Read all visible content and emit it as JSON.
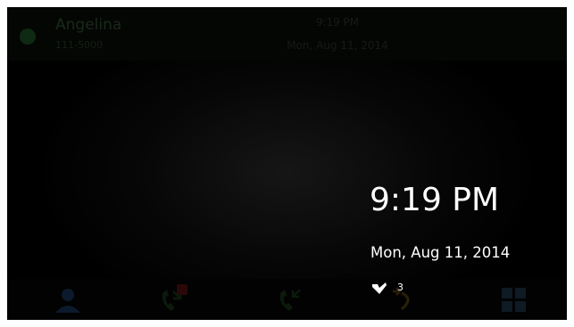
{
  "status_bar": {
    "account_name": "Angelina",
    "account_number": "111-5000",
    "time": "9:19 PM",
    "date": "Mon, Aug 11, 2014",
    "presence_color": "#0e2a12"
  },
  "screensaver": {
    "time": "9:19 PM",
    "date": "Mon, Aug 11, 2014",
    "voicemail_icon": "voicemail-icon",
    "voicemail_count": "3"
  },
  "softkeys": [
    {
      "icon": "contacts-icon"
    },
    {
      "icon": "missed-calls-icon",
      "badge": true
    },
    {
      "icon": "received-calls-icon"
    },
    {
      "icon": "call-forward-icon"
    },
    {
      "icon": "apps-grid-icon"
    }
  ],
  "colors": {
    "background": "#000000",
    "foreground": "#ffffff"
  }
}
